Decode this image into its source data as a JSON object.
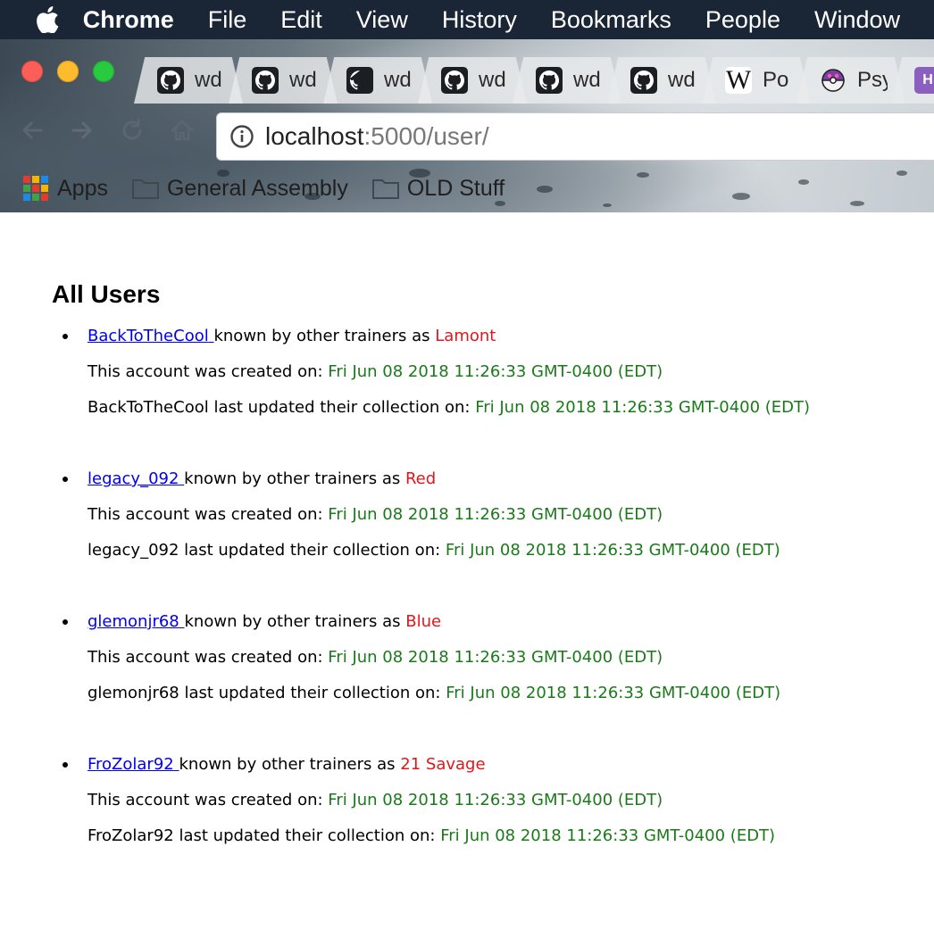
{
  "menubar": {
    "app_name": "Chrome",
    "items": [
      "File",
      "Edit",
      "View",
      "History",
      "Bookmarks",
      "People",
      "Window"
    ]
  },
  "tabs": [
    {
      "icon": "github-icon",
      "title": "wd"
    },
    {
      "icon": "github-icon",
      "title": "wd"
    },
    {
      "icon": "github-icon",
      "title": "wd"
    },
    {
      "icon": "github-icon",
      "title": "wd"
    },
    {
      "icon": "github-icon",
      "title": "wd"
    },
    {
      "icon": "github-icon",
      "title": "wd"
    },
    {
      "icon": "wikipedia-icon",
      "icon_glyph": "W",
      "title": "Po"
    },
    {
      "icon": "pokeball-icon",
      "title": "Psy"
    },
    {
      "icon": "heroku-icon",
      "icon_glyph": "H",
      "title": ""
    }
  ],
  "address_bar": {
    "host": "localhost",
    "path": ":5000/user/"
  },
  "bookmarks": [
    {
      "icon": "apps-grid-icon",
      "label": "Apps"
    },
    {
      "icon": "folder-icon",
      "label": "General Assembly"
    },
    {
      "icon": "folder-icon",
      "label": "OLD Stuff"
    }
  ],
  "page": {
    "title": "All Users",
    "known_as_text": "known by other trainers as",
    "created_text": "This account was created on:",
    "updated_text": "last updated their collection on:",
    "users": [
      {
        "username": "BackToTheCool",
        "nickname": "Lamont",
        "created": "Fri Jun 08 2018 11:26:33 GMT-0400 (EDT)",
        "updated": "Fri Jun 08 2018 11:26:33 GMT-0400 (EDT)"
      },
      {
        "username": "legacy_092",
        "nickname": "Red",
        "created": "Fri Jun 08 2018 11:26:33 GMT-0400 (EDT)",
        "updated": "Fri Jun 08 2018 11:26:33 GMT-0400 (EDT)"
      },
      {
        "username": "glemonjr68",
        "nickname": "Blue",
        "created": "Fri Jun 08 2018 11:26:33 GMT-0400 (EDT)",
        "updated": "Fri Jun 08 2018 11:26:33 GMT-0400 (EDT)"
      },
      {
        "username": "FroZolar92",
        "nickname": "21 Savage",
        "created": "Fri Jun 08 2018 11:26:33 GMT-0400 (EDT)",
        "updated": "Fri Jun 08 2018 11:26:33 GMT-0400 (EDT)"
      }
    ]
  },
  "colors": {
    "link": "#0000ee",
    "nickname": "#e0161b",
    "date": "#1a7a1a",
    "menubar": "#1a2536"
  }
}
